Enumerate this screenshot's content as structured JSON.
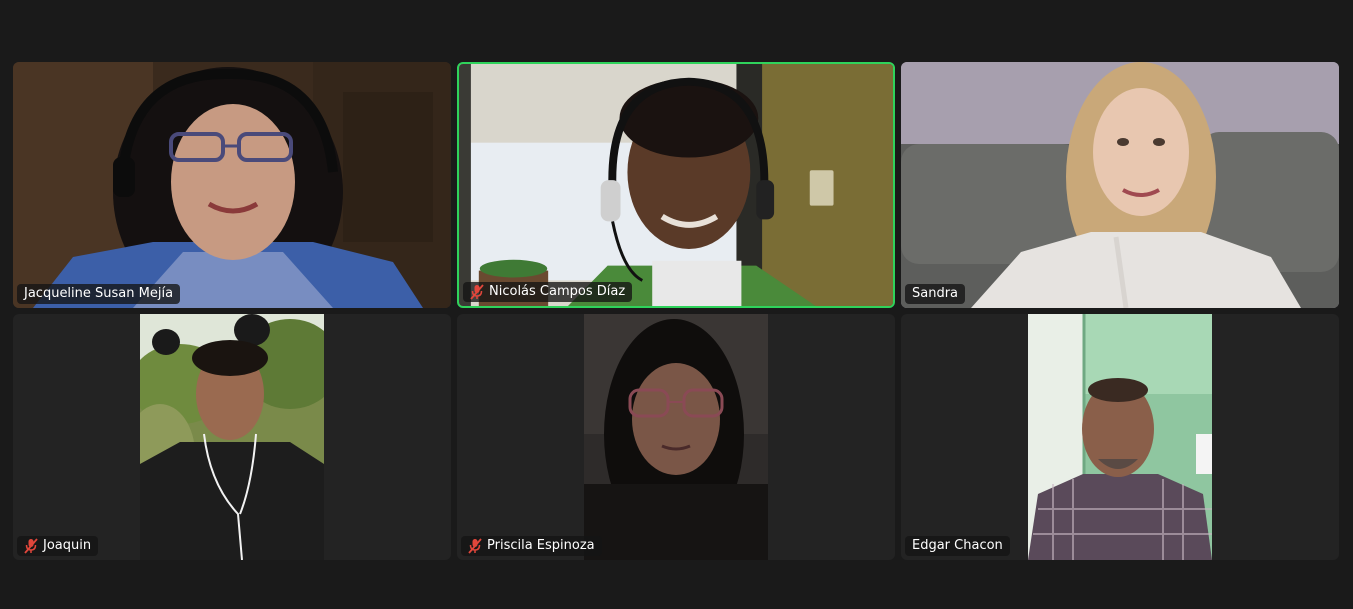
{
  "meeting": {
    "active_speaker_color": "#2fd35b",
    "muted_icon_color": "#e0463b",
    "participants": [
      {
        "name": "Jacqueline Susan Mejía",
        "muted": false,
        "active": false
      },
      {
        "name": "Nicolás Campos Díaz",
        "muted": true,
        "active": true
      },
      {
        "name": "Sandra",
        "muted": false,
        "active": false
      },
      {
        "name": "Joaquin",
        "muted": true,
        "active": false
      },
      {
        "name": "Priscila Espinoza",
        "muted": true,
        "active": false
      },
      {
        "name": "Edgar Chacon",
        "muted": false,
        "active": false
      }
    ]
  }
}
